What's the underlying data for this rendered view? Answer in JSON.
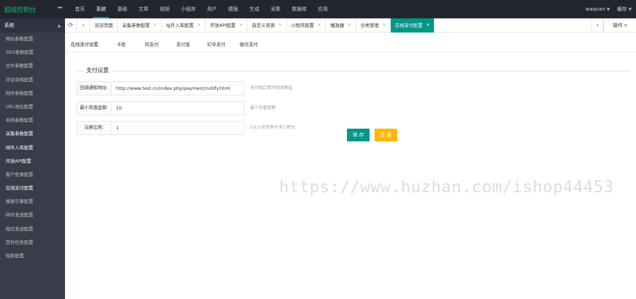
{
  "app": {
    "logo": "超级控制台"
  },
  "topnav": {
    "items": [
      "首页",
      "系统",
      "基础",
      "文章",
      "视频",
      "小程序",
      "用户",
      "模版",
      "生成",
      "采集",
      "数据库",
      "应用"
    ],
    "active_index": 1,
    "user": "waquan",
    "cache": "缓存"
  },
  "sidebar": {
    "title": "系统",
    "items": [
      "网站参数配置",
      "SEO参数配置",
      "文件参数配置",
      "评论审核配置",
      "附件参数配置",
      "URL地址配置",
      "系统参数配置",
      "采集参数配置",
      "邮件入库配置",
      "开放API配置",
      "客户登录配置",
      "在线支付配置",
      "搜索引擎配置",
      "邮件发送配置",
      "短信发送配置",
      "定时任务配置",
      "短邮配置"
    ]
  },
  "tabs": {
    "items": [
      {
        "label": "欢迎页面",
        "closable": false
      },
      {
        "label": "采集参数配置",
        "closable": true
      },
      {
        "label": "站外入库配置",
        "closable": true
      },
      {
        "label": "开放API配置",
        "closable": true
      },
      {
        "label": "自定义资源",
        "closable": true
      },
      {
        "label": "小程序配置",
        "closable": true
      },
      {
        "label": "播放器",
        "closable": true
      },
      {
        "label": "分类管理",
        "closable": true
      },
      {
        "label": "在线支付配置",
        "closable": true
      }
    ],
    "active_index": 8,
    "ops_label": "操作"
  },
  "subtabs": {
    "items": [
      "在线支付设置",
      "卡密",
      "码支付",
      "支付宝",
      "幻令支付",
      "微信支付"
    ],
    "active_index": 0
  },
  "form": {
    "section_title": "支付设置",
    "fields": [
      {
        "label": "回调通知地址:",
        "value": "http://www.test.cn/index.php/payment/notify.html",
        "hint": "支付接口填写回调地址"
      },
      {
        "label": "最小充值金额:",
        "value": "10",
        "hint": "最少充值金额"
      },
      {
        "label": "兑换比例:",
        "value": "1",
        "hint": "1元人民币等于多少积分"
      }
    ],
    "save_label": "保 存",
    "reset_label": "还 原"
  },
  "watermark": "https://www.huzhan.com/ishop44453",
  "colors": {
    "accent": "#009688",
    "warning": "#ffb800",
    "topbar": "#23262e",
    "sidebar": "#393d49",
    "logo": "#16b777"
  }
}
